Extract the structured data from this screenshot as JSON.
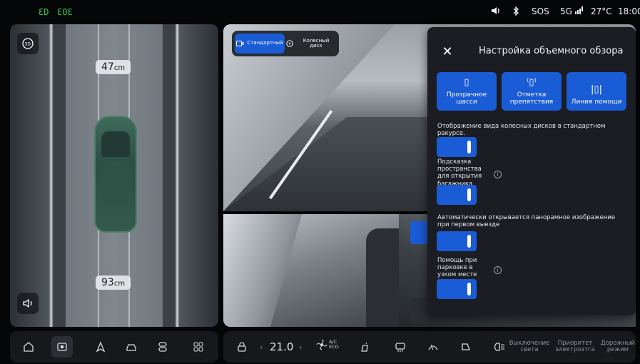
{
  "status_bar": {
    "left_indicators": [
      "ƐD",
      "ƐOƐ"
    ],
    "volume_icon": "volume-icon",
    "bluetooth_icon": "bluetooth-icon",
    "sos": "SOS",
    "network": "5G",
    "temperature": "27°C",
    "time": "18:00",
    "indicator_color": "#3ccf4a"
  },
  "left_view": {
    "distance_front": "47",
    "distance_rear": "93",
    "unit": "cm",
    "btn_3d": "3D"
  },
  "view_toggle": {
    "standard": "Стандартный",
    "wheel": "Колесный диск"
  },
  "panel": {
    "title": "Настройка объемного обзора",
    "tiles": [
      {
        "label": "Прозрачное шасси",
        "icon": "transparent-chassis-icon"
      },
      {
        "label": "Отметка препятствия",
        "icon": "obstacle-mark-icon"
      },
      {
        "label": "Линия помощи",
        "icon": "guide-line-icon"
      }
    ],
    "wheel_text": "Отображение вида колесных дисков в стандартном ракурсе.",
    "trunk_hint": "Подсказка пространства для открытия багажника",
    "auto_open_text": "Автоматически открывается панорамное изображение при первом выезде",
    "narrow_parking": "Помощь при парковке в узком месте",
    "accent": "#1a5bd6"
  },
  "bottom_bar": {
    "temperature": "21.0",
    "ac_label": "A/C",
    "eco_label": "ECO",
    "power_off": "Выключение света",
    "energy_priority": "Приоритет электрозтга",
    "road_mode": "Дорожный режим"
  }
}
